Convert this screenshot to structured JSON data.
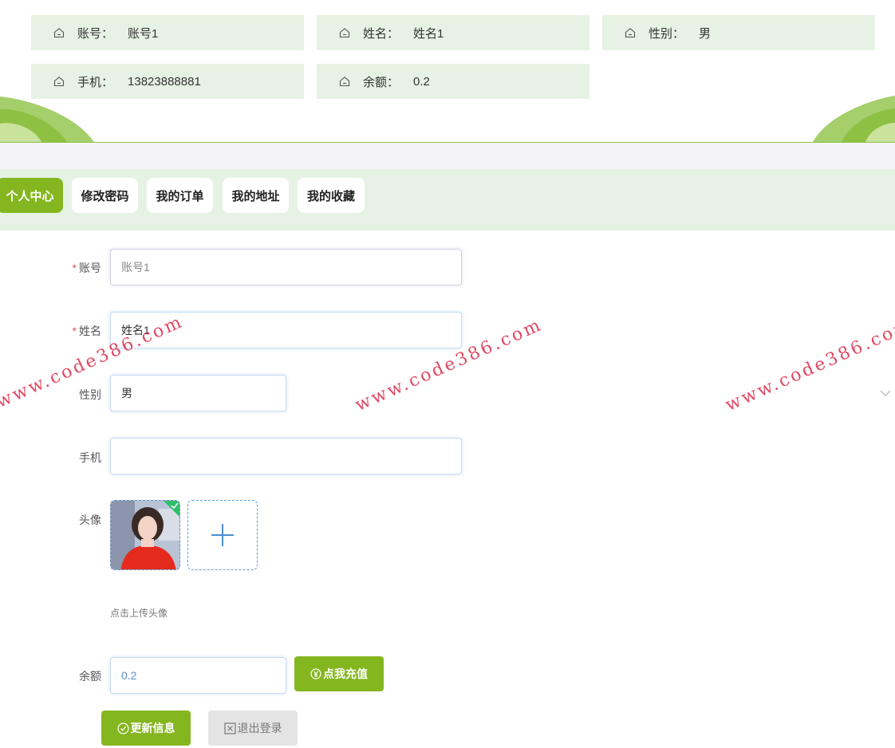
{
  "info_cards": [
    {
      "label": "账号：",
      "value": "账号1"
    },
    {
      "label": "姓名：",
      "value": "姓名1"
    },
    {
      "label": "性别：",
      "value": "男"
    },
    {
      "label": "手机：",
      "value": "13823888881"
    },
    {
      "label": "余额：",
      "value": "0.2"
    }
  ],
  "tabs": [
    {
      "label": "个人中心",
      "active": true
    },
    {
      "label": "修改密码",
      "active": false
    },
    {
      "label": "我的订单",
      "active": false
    },
    {
      "label": "我的地址",
      "active": false
    },
    {
      "label": "我的收藏",
      "active": false
    }
  ],
  "form": {
    "account": {
      "label": "账号",
      "required": "*",
      "value": "账号1"
    },
    "name": {
      "label": "姓名",
      "required": "*",
      "value": "姓名1"
    },
    "gender": {
      "label": "性别",
      "value": "男"
    },
    "phone": {
      "label": "手机",
      "value": ""
    },
    "avatar": {
      "label": "头像",
      "hint": "点击上传头像"
    },
    "balance": {
      "label": "余额",
      "value": "0.2"
    }
  },
  "buttons": {
    "recharge": "点我充值",
    "update": "更新信息",
    "logout": "退出登录"
  },
  "watermark": "www.code386.com",
  "colors": {
    "accent": "#84b61f",
    "card_bg": "#e6f2e3",
    "required": "#e55050"
  }
}
